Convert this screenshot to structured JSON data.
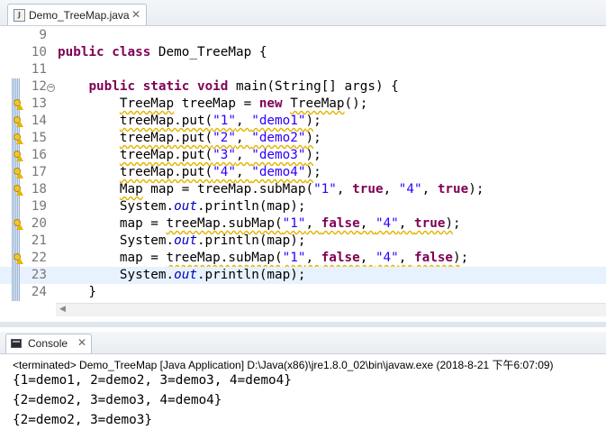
{
  "editor": {
    "tab_label": "Demo_TreeMap.java",
    "tab_icon": "java-file-icon",
    "tab_close": "✕",
    "lines": [
      {
        "num": "9",
        "tokens": []
      },
      {
        "num": "10",
        "tokens": [
          [
            "kw",
            "public"
          ],
          [
            "t",
            " "
          ],
          [
            "kw",
            "class"
          ],
          [
            "t",
            " Demo_TreeMap {"
          ]
        ]
      },
      {
        "num": "11",
        "tokens": []
      },
      {
        "num": "12",
        "fold": "−",
        "tokens": [
          [
            "t",
            "    "
          ],
          [
            "kw",
            "public"
          ],
          [
            "t",
            " "
          ],
          [
            "kw",
            "static"
          ],
          [
            "t",
            " "
          ],
          [
            "kw",
            "void"
          ],
          [
            "t",
            " main(String[] args) {"
          ]
        ]
      },
      {
        "num": "13",
        "warn": true,
        "tokens": [
          [
            "t",
            "        "
          ],
          [
            "sq",
            "TreeMap"
          ],
          [
            "t",
            " treeMap = "
          ],
          [
            "kw",
            "new"
          ],
          [
            "t",
            " "
          ],
          [
            "sq",
            "TreeMap"
          ],
          [
            "t",
            "();"
          ]
        ]
      },
      {
        "num": "14",
        "warn": true,
        "tokens": [
          [
            "t",
            "        "
          ],
          [
            "sq",
            "treeMap.put("
          ],
          [
            "sqs",
            "\"1\""
          ],
          [
            "sq",
            ", "
          ],
          [
            "sqs",
            "\"demo1\""
          ],
          [
            "sq",
            ")"
          ],
          [
            "t",
            ";"
          ]
        ]
      },
      {
        "num": "15",
        "warn": true,
        "tokens": [
          [
            "t",
            "        "
          ],
          [
            "sq",
            "treeMap.put("
          ],
          [
            "sqs",
            "\"2\""
          ],
          [
            "sq",
            ", "
          ],
          [
            "sqs",
            "\"demo2\""
          ],
          [
            "sq",
            ")"
          ],
          [
            "t",
            ";"
          ]
        ]
      },
      {
        "num": "16",
        "warn": true,
        "tokens": [
          [
            "t",
            "        "
          ],
          [
            "sq",
            "treeMap.put("
          ],
          [
            "sqs",
            "\"3\""
          ],
          [
            "sq",
            ", "
          ],
          [
            "sqs",
            "\"demo3\""
          ],
          [
            "sq",
            ")"
          ],
          [
            "t",
            ";"
          ]
        ]
      },
      {
        "num": "17",
        "warn": true,
        "tokens": [
          [
            "t",
            "        "
          ],
          [
            "sq",
            "treeMap.put("
          ],
          [
            "sqs",
            "\"4\""
          ],
          [
            "sq",
            ", "
          ],
          [
            "sqs",
            "\"demo4\""
          ],
          [
            "sq",
            ")"
          ],
          [
            "t",
            ";"
          ]
        ]
      },
      {
        "num": "18",
        "warn": true,
        "tokens": [
          [
            "t",
            "        "
          ],
          [
            "sq",
            "Map"
          ],
          [
            "t",
            " map = treeMap.subMap("
          ],
          [
            "str",
            "\"1\""
          ],
          [
            "t",
            ", "
          ],
          [
            "kw",
            "true"
          ],
          [
            "t",
            ", "
          ],
          [
            "str",
            "\"4\""
          ],
          [
            "t",
            ", "
          ],
          [
            "kw",
            "true"
          ],
          [
            "t",
            ");"
          ]
        ]
      },
      {
        "num": "19",
        "tokens": [
          [
            "t",
            "        System."
          ],
          [
            "st",
            "out"
          ],
          [
            "t",
            ".println(map);"
          ]
        ]
      },
      {
        "num": "20",
        "warn": true,
        "tokens": [
          [
            "t",
            "        map = "
          ],
          [
            "sq",
            "treeMap.subMap("
          ],
          [
            "sqs",
            "\"1\""
          ],
          [
            "sq",
            ", "
          ],
          [
            "sqk",
            "false"
          ],
          [
            "sq",
            ", "
          ],
          [
            "sqs",
            "\"4\""
          ],
          [
            "sq",
            ", "
          ],
          [
            "sqk",
            "true"
          ],
          [
            "sq",
            ")"
          ],
          [
            "t",
            ";"
          ]
        ]
      },
      {
        "num": "21",
        "tokens": [
          [
            "t",
            "        System."
          ],
          [
            "st",
            "out"
          ],
          [
            "t",
            ".println(map);"
          ]
        ]
      },
      {
        "num": "22",
        "warn": true,
        "tokens": [
          [
            "t",
            "        map = "
          ],
          [
            "sq",
            "treeMap.subMap("
          ],
          [
            "sqs",
            "\"1\""
          ],
          [
            "sq",
            ", "
          ],
          [
            "sqk",
            "false"
          ],
          [
            "sq",
            ", "
          ],
          [
            "sqs",
            "\"4\""
          ],
          [
            "sq",
            ", "
          ],
          [
            "sqk",
            "false"
          ],
          [
            "sq",
            ")"
          ],
          [
            "t",
            ";"
          ]
        ]
      },
      {
        "num": "23",
        "highlight": true,
        "tokens": [
          [
            "t",
            "        System."
          ],
          [
            "st",
            "out"
          ],
          [
            "t",
            ".println(map);"
          ]
        ]
      },
      {
        "num": "24",
        "tokens": [
          [
            "t",
            "    }"
          ]
        ]
      }
    ]
  },
  "console": {
    "tab_label": "Console",
    "tab_icon": "console-icon",
    "tab_close": "✕",
    "status": "<terminated> Demo_TreeMap [Java Application] D:\\Java(x86)\\jre1.8.0_02\\bin\\javaw.exe (2018-8-21 下午6:07:09)",
    "output": [
      "{1=demo1, 2=demo2, 3=demo3, 4=demo4}",
      "{2=demo2, 3=demo3, 4=demo4}",
      "{2=demo2, 3=demo3}"
    ]
  },
  "colors": {
    "keyword": "#7f0055",
    "string": "#2a00ff",
    "static_field": "#0000c0",
    "warning_underline": "#e4b400",
    "current_line": "#e8f2fe"
  }
}
